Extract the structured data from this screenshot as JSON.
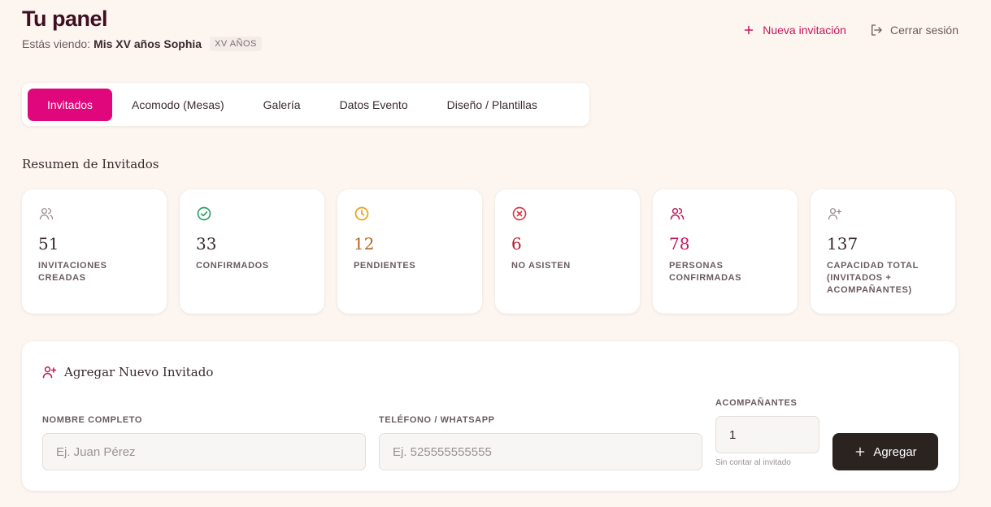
{
  "header": {
    "title": "Tu panel",
    "viewing_label": "Estás viendo:",
    "event_name": "Mis XV años Sophia",
    "event_badge": "XV AÑOS"
  },
  "actions": {
    "new_invitation": "Nueva invitación",
    "logout": "Cerrar sesión"
  },
  "tabs": [
    {
      "label": "Invitados",
      "active": true
    },
    {
      "label": "Acomodo (Mesas)",
      "active": false
    },
    {
      "label": "Galería",
      "active": false
    },
    {
      "label": "Datos Evento",
      "active": false
    },
    {
      "label": "Diseño / Plantillas",
      "active": false
    }
  ],
  "summary": {
    "title": "Resumen de Invitados",
    "stats": [
      {
        "value": "51",
        "label": "INVITACIONES CREADAS",
        "icon": "users-icon",
        "color": "#9a9093"
      },
      {
        "value": "33",
        "label": "CONFIRMADOS",
        "icon": "check-circle-icon",
        "color": "#2e9e6a"
      },
      {
        "value": "12",
        "label": "PENDIENTES",
        "icon": "clock-icon",
        "color": "#e8a012"
      },
      {
        "value": "6",
        "label": "NO ASISTEN",
        "icon": "x-circle-icon",
        "color": "#d63a4a"
      },
      {
        "value": "78",
        "label": "PERSONAS CONFIRMADAS",
        "icon": "users-icon",
        "color": "#c2185b"
      },
      {
        "value": "137",
        "label": "CAPACIDAD TOTAL (INVITADOS + ACOMPAÑANTES)",
        "icon": "user-plus-icon",
        "color": "#9a9093"
      }
    ]
  },
  "form": {
    "title": "Agregar Nuevo Invitado",
    "name_label": "NOMBRE COMPLETO",
    "name_placeholder": "Ej. Juan Pérez",
    "phone_label": "TELÉFONO / WHATSAPP",
    "phone_placeholder": "Ej. 525555555555",
    "companions_label": "ACOMPAÑANTES",
    "companions_value": "1",
    "companions_hint": "Sin contar al invitado",
    "submit_label": "Agregar"
  },
  "colors": {
    "accent": "#e0067b",
    "brand_text": "#c2185b",
    "background": "#fdf5f0",
    "dark_button": "#2a2320"
  }
}
